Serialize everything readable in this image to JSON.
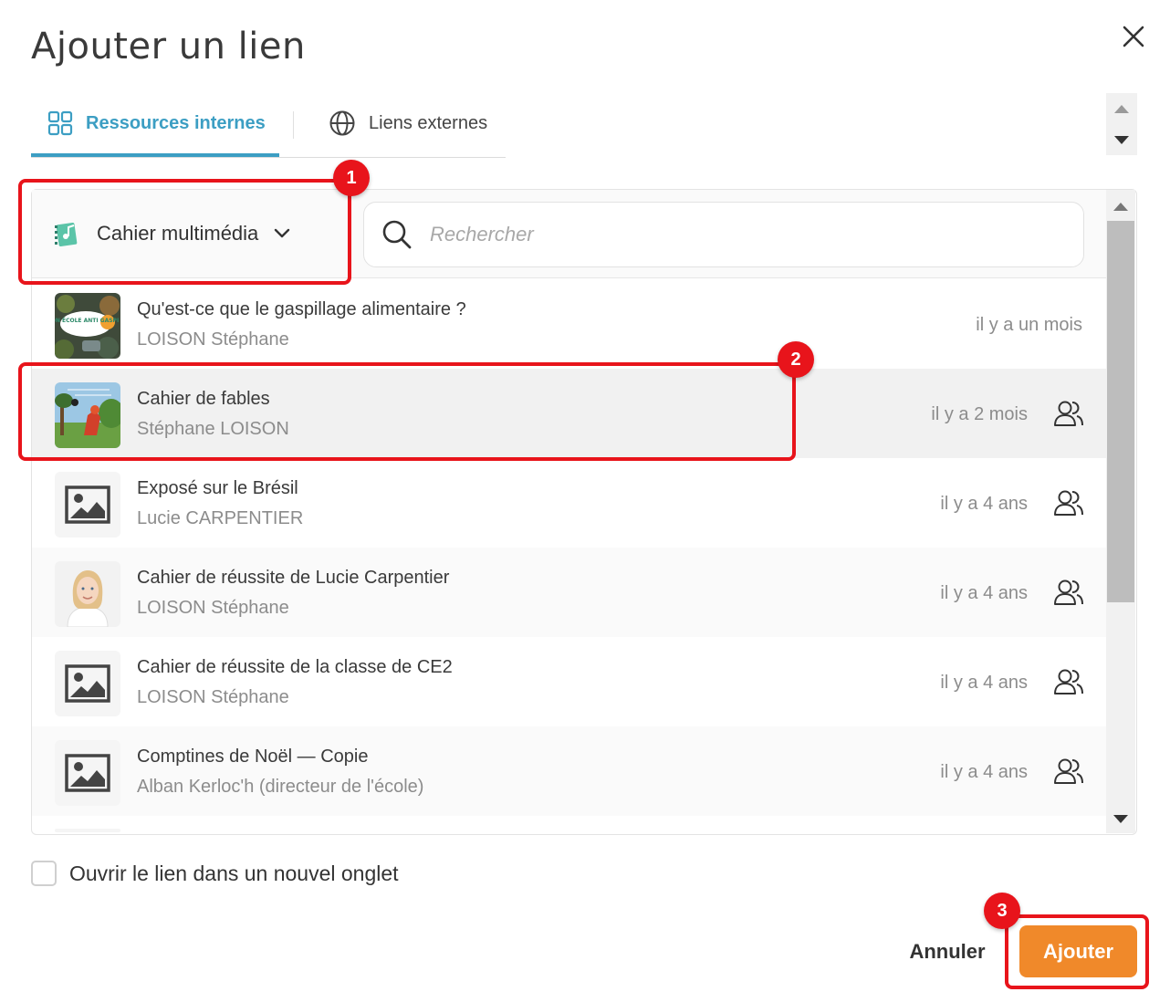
{
  "dialog": {
    "title": "Ajouter un lien",
    "close_icon": "close-icon"
  },
  "tabs": [
    {
      "label": "Ressources internes",
      "icon": "grid-icon",
      "active": true
    },
    {
      "label": "Liens externes",
      "icon": "globe-icon",
      "active": false
    }
  ],
  "filter": {
    "label": "Cahier multimédia",
    "icon": "multimedia-notebook-icon"
  },
  "search": {
    "placeholder": "Rechercher",
    "value": ""
  },
  "items": [
    {
      "title": "Qu'est-ce que le gaspillage alimentaire ?",
      "author": "LOISON Stéphane",
      "date": "il y a un mois",
      "shared": false,
      "thumb_text": "MON ÉCOLE ANTI GASPI"
    },
    {
      "title": "Cahier de fables",
      "author": "Stéphane LOISON",
      "date": "il y a 2 mois",
      "shared": true,
      "selected": true
    },
    {
      "title": "Exposé sur le Brésil",
      "author": "Lucie CARPENTIER",
      "date": "il y a 4 ans",
      "shared": true
    },
    {
      "title": "Cahier de réussite de Lucie Carpentier",
      "author": "LOISON Stéphane",
      "date": "il y a 4 ans",
      "shared": true
    },
    {
      "title": "Cahier de réussite de la classe de CE2",
      "author": "LOISON Stéphane",
      "date": "il y a 4 ans",
      "shared": true
    },
    {
      "title": "Comptines de Noël — Copie",
      "author": "Alban Kerloc'h (directeur de l'école)",
      "date": "il y a 4 ans",
      "shared": true
    }
  ],
  "options": {
    "open_new_tab_label": "Ouvrir le lien dans un nouvel onglet",
    "open_new_tab_checked": false
  },
  "actions": {
    "cancel_label": "Annuler",
    "add_label": "Ajouter"
  },
  "annotations": [
    "1",
    "2",
    "3"
  ],
  "colors": {
    "accent": "#3c9ec3",
    "primary_button": "#f0892a",
    "annotation": "#e8141b"
  }
}
